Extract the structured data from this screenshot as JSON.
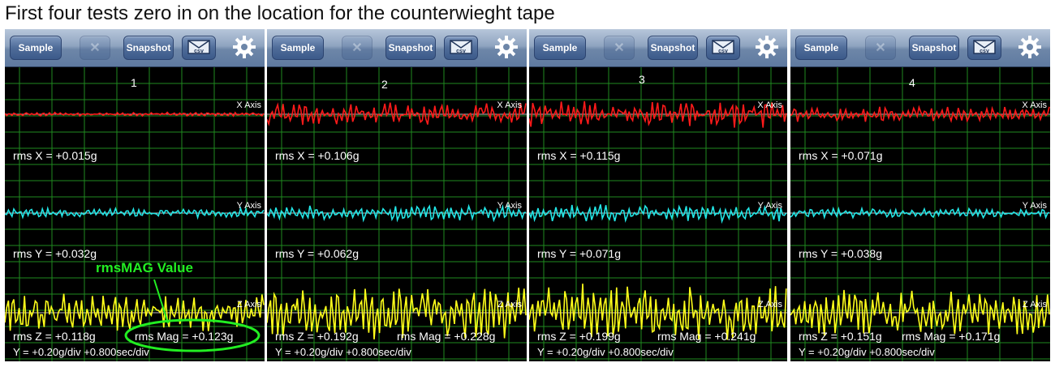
{
  "title": "First four tests zero in on the location for the counterwieght tape",
  "toolbar": {
    "sample_label": "Sample",
    "snapshot_label": "Snapshot",
    "close_glyph": "✕",
    "csv_label": "csv",
    "icons": [
      "close-icon",
      "mail-csv-icon",
      "gear-icon"
    ]
  },
  "axis_labels": {
    "x": "X Axis",
    "y": "Y Axis",
    "z": "Z Axis"
  },
  "colors": {
    "x_trace": "#ff1a1a",
    "y_trace": "#22e6e6",
    "z_trace": "#ffff1a",
    "grid": "#1f8a1f",
    "annotation": "#22ee22"
  },
  "annotation": {
    "label": "rmsMAG Value"
  },
  "panels": [
    {
      "number": "1",
      "rms_x": "rms X = +0.015g",
      "rms_y": "rms Y = +0.032g",
      "rms_z": "rms Z = +0.118g",
      "rms_mag": "rms Mag = +0.123g",
      "scale": "Y = +0.20g/div   +0.800sec/div"
    },
    {
      "number": "2",
      "rms_x": "rms X = +0.106g",
      "rms_y": "rms Y = +0.062g",
      "rms_z": "rms Z = +0.192g",
      "rms_mag": "rms Mag = +0.228g",
      "scale": "Y = +0.20g/div   +0.800sec/div"
    },
    {
      "number": "3",
      "rms_x": "rms X = +0.115g",
      "rms_y": "rms Y = +0.071g",
      "rms_z": "rms Z = +0.199g",
      "rms_mag": "rms Mag = +0.241g",
      "scale": "Y = +0.20g/div   +0.800sec/div"
    },
    {
      "number": "4",
      "rms_x": "rms X = +0.071g",
      "rms_y": "rms Y = +0.038g",
      "rms_z": "rms Z = +0.151g",
      "rms_mag": "rms Mag = +0.171g",
      "scale": "Y = +0.20g/div   +0.800sec/div"
    }
  ]
}
